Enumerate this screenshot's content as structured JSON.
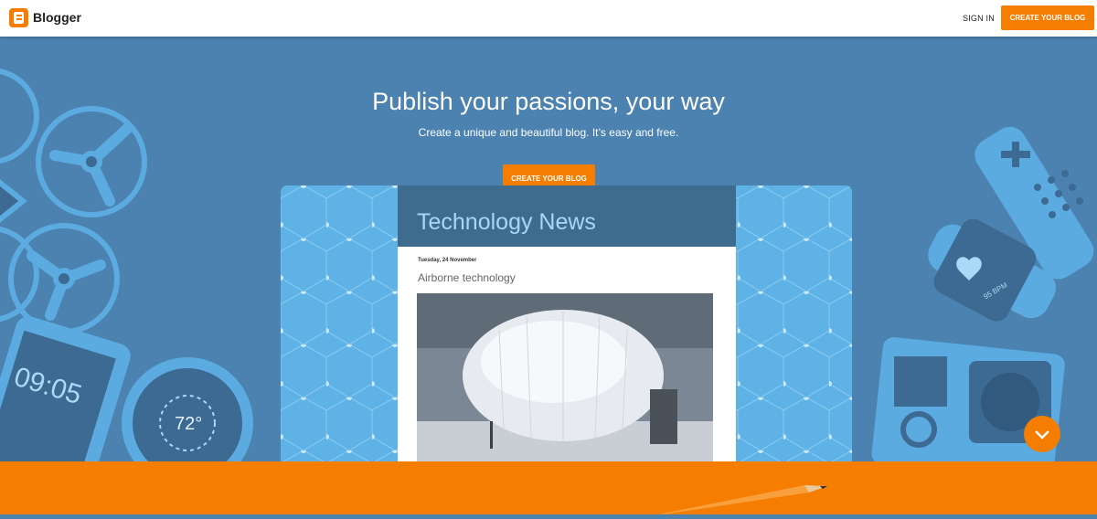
{
  "header": {
    "brand": "Blogger",
    "sign_in": "SIGN IN",
    "create_blog": "CREATE YOUR BLOG"
  },
  "hero": {
    "title": "Publish your passions, your way",
    "subtitle": "Create a unique and beautiful blog. It’s easy and free.",
    "cta": "CREATE YOUR BLOG"
  },
  "preview": {
    "blog_title": "Technology News",
    "date": "Tuesday, 24 November",
    "post_title": "Airborne technology"
  },
  "illustrations": {
    "phone_time": "09:05",
    "thermostat_temp": "72°",
    "watch_bpm": "95 BPM"
  },
  "icons": {
    "logo": "blogger-logo-icon",
    "scroll": "chevron-down-icon"
  },
  "colors": {
    "accent": "#f57d00",
    "hero_bg": "#4b82af",
    "card_bg": "#5eb2e6",
    "header_bg": "#3e6c8f"
  }
}
